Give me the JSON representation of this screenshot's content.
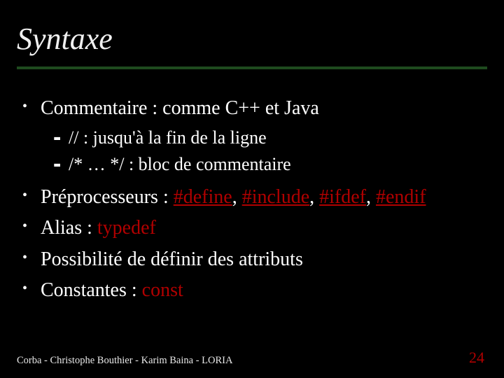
{
  "title": "Syntaxe",
  "bullets": {
    "comment": {
      "label": "Commentaire : comme C++ et Java",
      "sub1": "// : jusqu'à la fin de la ligne",
      "sub2": "/* … */ : bloc de commentaire"
    },
    "preproc": {
      "prefix": "Préprocesseurs : ",
      "k1": "#define",
      "k2": "#include",
      "k3": "#ifdef",
      "k4": "#endif",
      "sep": ", "
    },
    "alias": {
      "prefix": "Alias : ",
      "kw": "typedef"
    },
    "attrs": "Possibilité de définir des attributs",
    "consts": {
      "prefix": "Constantes : ",
      "kw": "const"
    }
  },
  "footer": "Corba - Christophe Bouthier - Karim Baina - LORIA",
  "page": "24"
}
